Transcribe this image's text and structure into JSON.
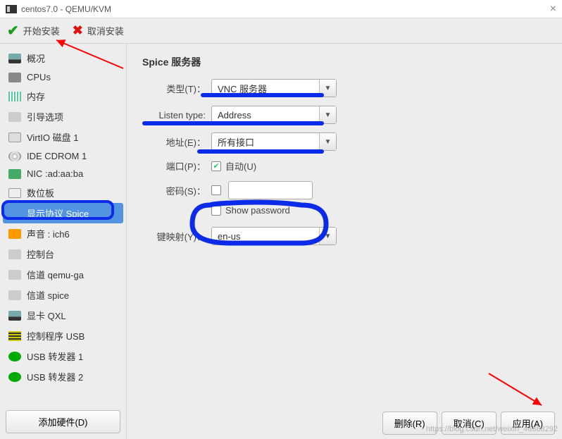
{
  "titlebar": {
    "title": "centos7.0 - QEMU/KVM"
  },
  "toolbar": {
    "begin_install": "开始安装",
    "cancel_install": "取消安装"
  },
  "sidebar": {
    "items": [
      {
        "label": "概况",
        "icon": "ico-mon"
      },
      {
        "label": "CPUs",
        "icon": "ico-cpu"
      },
      {
        "label": "内存",
        "icon": "ico-mem"
      },
      {
        "label": "引导选项",
        "icon": "ico-boot"
      },
      {
        "label": "VirtIO 磁盘 1",
        "icon": "ico-disk"
      },
      {
        "label": "IDE CDROM 1",
        "icon": "ico-cd"
      },
      {
        "label": "NIC :ad:aa:ba",
        "icon": "ico-nic"
      },
      {
        "label": "数位板",
        "icon": "ico-tablet"
      },
      {
        "label": "显示协议 Spice",
        "icon": "ico-display",
        "selected": true
      },
      {
        "label": "声音 : ich6",
        "icon": "ico-sound"
      },
      {
        "label": "控制台",
        "icon": "ico-console"
      },
      {
        "label": "信道 qemu-ga",
        "icon": "ico-console"
      },
      {
        "label": "信道 spice",
        "icon": "ico-console"
      },
      {
        "label": "显卡 QXL",
        "icon": "ico-mon"
      },
      {
        "label": "控制程序 USB",
        "icon": "ico-usbctrl"
      },
      {
        "label": "USB 转发器 1",
        "icon": "ico-usb"
      },
      {
        "label": "USB 转发器 2",
        "icon": "ico-usb"
      }
    ],
    "add_hardware": "添加硬件(D)"
  },
  "main": {
    "section_title": "Spice 服务器",
    "labels": {
      "type": "类型(T)：",
      "listen_type": "Listen type:",
      "address": "地址(E)：",
      "port": "端口(P)：",
      "password": "密码(S)：",
      "keymap": "键映射(Y)："
    },
    "values": {
      "type": "VNC 服务器",
      "listen_type": "Address",
      "address": "所有接口",
      "port_auto_label": "自动(U)",
      "port_auto_checked": true,
      "show_password_label": "Show password",
      "show_password_checked": false,
      "keymap": "en-us"
    }
  },
  "footer": {
    "delete": "删除(R)",
    "cancel": "取消(C)",
    "apply": "应用(A)"
  },
  "watermark": "https://blog.csdn.net/weixin_46368292"
}
